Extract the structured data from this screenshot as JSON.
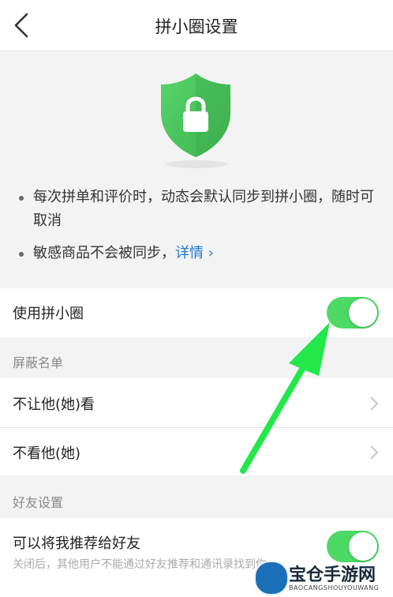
{
  "header": {
    "title": "拼小圈设置"
  },
  "hero": {
    "bullets": [
      {
        "text": "每次拼单和评价时，动态会默认同步到拼小圈，随时可取消"
      },
      {
        "text": "敏感商品不会被同步，",
        "link": "详情 ›"
      }
    ]
  },
  "settings": {
    "use_pinxiaoquan": {
      "label": "使用拼小圈",
      "enabled": true
    },
    "block_list": {
      "title": "屏蔽名单",
      "items": [
        {
          "label": "不让他(她)看"
        },
        {
          "label": "不看他(她)"
        }
      ]
    },
    "friend_settings": {
      "title": "好友设置",
      "recommend": {
        "label": "可以将我推荐给好友",
        "description": "关闭后，其他用户不能通过好友推荐和通讯录找到你",
        "enabled": true
      }
    }
  },
  "watermark": {
    "name": "宝仓手游网",
    "domain": "BAOCANGSHOUYOUWANG"
  },
  "colors": {
    "toggle_on": "#4cd964",
    "shield": "#4cc35a",
    "link": "#1f78d1",
    "arrow": "#22e84a"
  },
  "icons": {
    "back": "chevron-left-icon",
    "shield": "shield-lock-icon",
    "row_chevron": "chevron-right-icon"
  }
}
